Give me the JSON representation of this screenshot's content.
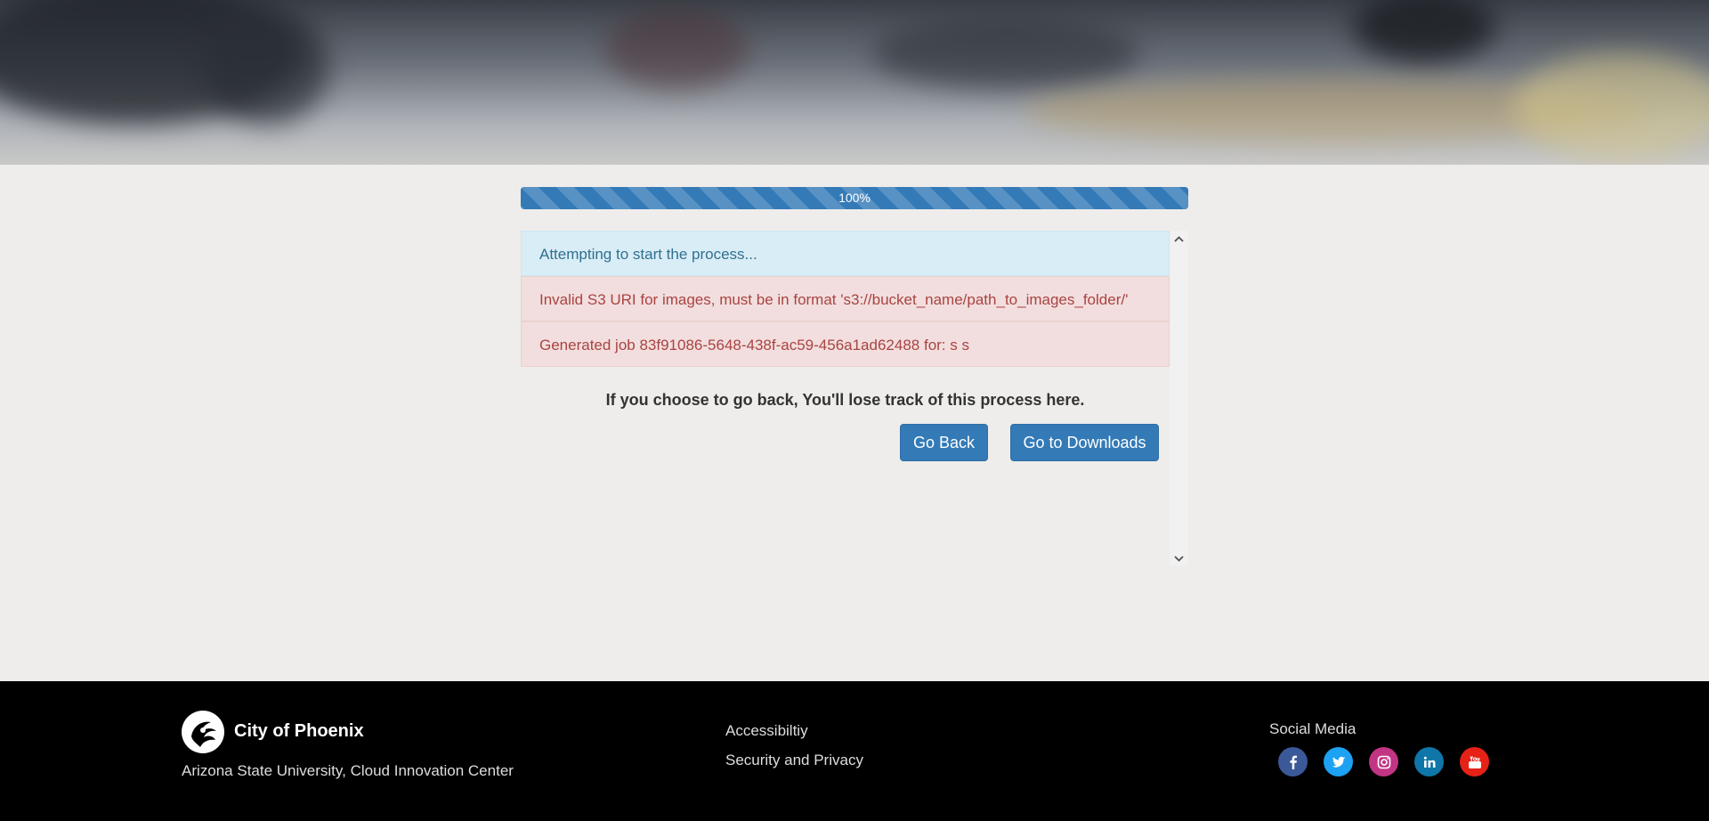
{
  "progress": {
    "value": 1.0,
    "label": "100%"
  },
  "messages": [
    {
      "type": "info",
      "text": "Attempting to start the process..."
    },
    {
      "type": "danger",
      "text": "Invalid S3 URI for images, must be in format 's3://bucket_name/path_to_images_folder/'"
    },
    {
      "type": "danger",
      "text": "Generated job 83f91086-5648-438f-ac59-456a1ad62488 for: s s"
    }
  ],
  "warning": "If you choose to go back, You'll lose track of this process here.",
  "buttons": {
    "back": "Go Back",
    "downloads": "Go to Downloads"
  },
  "footer": {
    "brand": "City of Phoenix",
    "org": "Arizona State University, Cloud Innovation Center",
    "links": {
      "accessibility": "Accessibiltiy",
      "security": "Security and Privacy"
    },
    "social_title": "Social Media",
    "social": [
      {
        "name": "facebook-icon",
        "color": "#3b5998"
      },
      {
        "name": "twitter-icon",
        "color": "#1da1f2"
      },
      {
        "name": "instagram-icon",
        "color": "#c13584"
      },
      {
        "name": "linkedin-icon",
        "color": "#0e76a8"
      },
      {
        "name": "youtube-icon",
        "color": "#e62117"
      }
    ]
  },
  "colors": {
    "primary": "#337ab7",
    "info_bg": "#d9edf7",
    "danger_bg": "#f2dede"
  }
}
